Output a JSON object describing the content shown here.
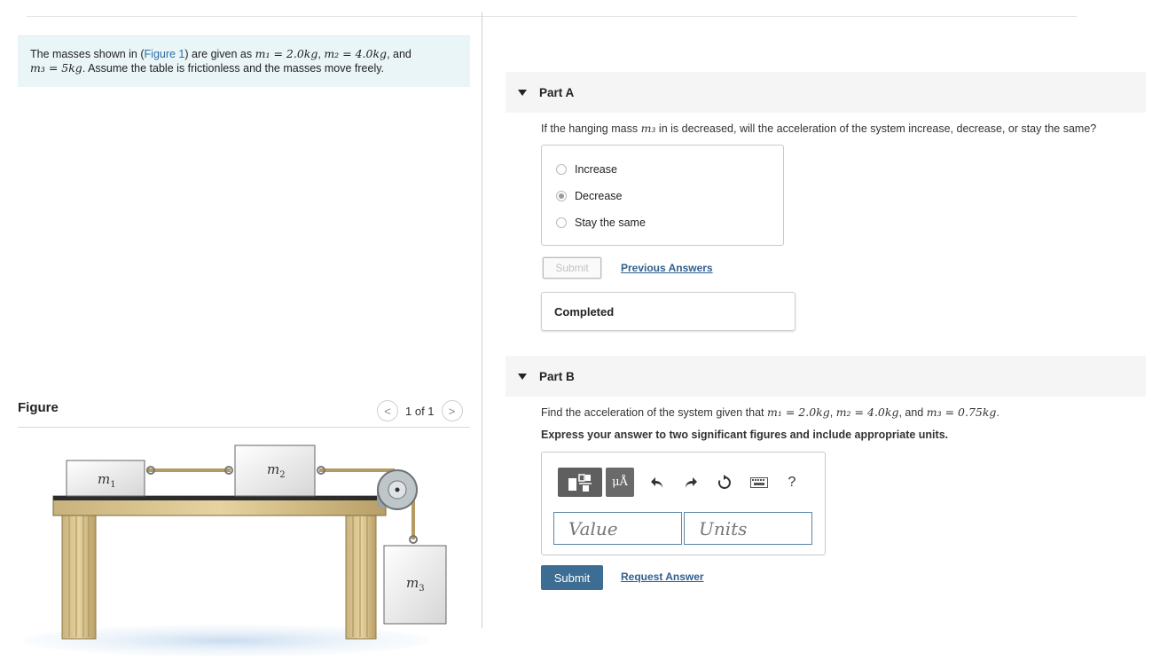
{
  "problem": {
    "text_before_link": "The masses shown in (",
    "figure_link": "Figure 1",
    "text_after_link": ") are given as ",
    "m1_expr": "m₁ = 2.0kg",
    "sep1": ", ",
    "m2_expr": "m₂ = 4.0kg",
    "sep2": ", and",
    "m3_expr": "m₃ = 5kg",
    "text_end": ". Assume the table is frictionless and the masses move freely."
  },
  "figure": {
    "title": "Figure",
    "pager_prev": "<",
    "pager_text": "1 of 1",
    "pager_next": ">",
    "label_m1": "m",
    "label_m1_sub": "1",
    "label_m2": "m",
    "label_m2_sub": "2",
    "label_m3": "m",
    "label_m3_sub": "3"
  },
  "partA": {
    "title": "Part A",
    "question_before": "If the hanging mass ",
    "question_var": "m₃",
    "question_after": " in is decreased, will the acceleration of the system increase, decrease, or stay the same?",
    "options": [
      "Increase",
      "Decrease",
      "Stay the same"
    ],
    "selected": "Decrease",
    "submit_label": "Submit",
    "previous_answers": "Previous Answers",
    "status": "Completed"
  },
  "partB": {
    "title": "Part B",
    "question_before": "Find the acceleration of the system given that ",
    "q_m1": "m₁ = 2.0kg",
    "q_sep1": ", ",
    "q_m2": "m₂ = 4.0kg",
    "q_sep2": ", and ",
    "q_m3": "m₃ = 0.75kg",
    "question_end": ".",
    "instruction": "Express your answer to two significant figures and include appropriate units.",
    "units_button": "μÅ",
    "help_label": "?",
    "value_placeholder": "Value",
    "units_placeholder": "Units",
    "submit_label": "Submit",
    "request_answer": "Request Answer"
  },
  "colors": {
    "problem_bg": "#eaf5f7",
    "link": "#2d6ea5",
    "submit_bg": "#3d6d93",
    "input_border": "#5a86a9"
  }
}
